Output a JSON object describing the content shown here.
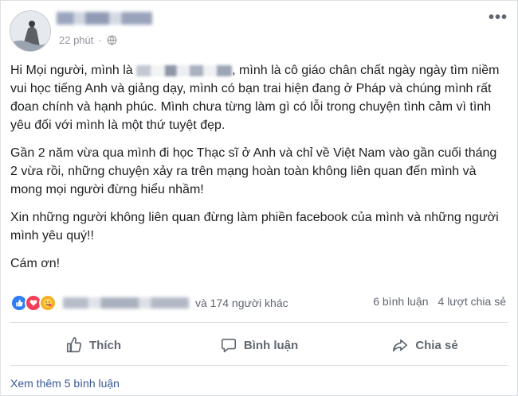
{
  "post": {
    "timestamp": "22 phút",
    "dot": "·",
    "paragraph1_pre": "Hi Mọi người, mình là",
    "paragraph1_post": ", mình là cô giáo chân chất ngày ngày tìm niềm vui học tiếng Anh và giảng dạy, mình có bạn trai hiện đang ở Pháp và chúng mình rất đoan chính và hạnh phúc. Mình chưa từng làm gì có lỗi trong chuyện tình cảm vì tình yêu đối với mình là một thứ tuyệt đẹp.",
    "paragraph2": "Gần 2 năm vừa qua mình đi học Thạc sĩ ở Anh và chỉ về Việt Nam vào gần cuối tháng 2 vừa rồi, những chuyện xảy ra trên mạng hoàn toàn không liên quan đến mình và mong mọi người đừng hiểu nhầm!",
    "paragraph3": "Xin những người không liên quan đừng làm phiền facebook của mình và những người mình yêu quý!!",
    "paragraph4": "Cám ơn!"
  },
  "reactions": {
    "others_text": "và 174 người khác",
    "comments_count": "6 bình luận",
    "shares_count": "4 lượt chia sẻ"
  },
  "actions": {
    "like_label": "Thích",
    "comment_label": "Bình luận",
    "share_label": "Chia sẻ"
  },
  "footer": {
    "more_comments": "Xem thêm 5 bình luận"
  },
  "icons": {
    "globe": "globe-icon",
    "more": "more-options-icon",
    "like": "thumbs-up-icon",
    "comment": "comment-bubble-icon",
    "share": "share-arrow-icon"
  },
  "colors": {
    "like_blue": "#2e7cf6",
    "love_red": "#f33e58",
    "haha_yellow": "#f7b125",
    "link_blue": "#385898",
    "muted_gray": "#606770"
  }
}
